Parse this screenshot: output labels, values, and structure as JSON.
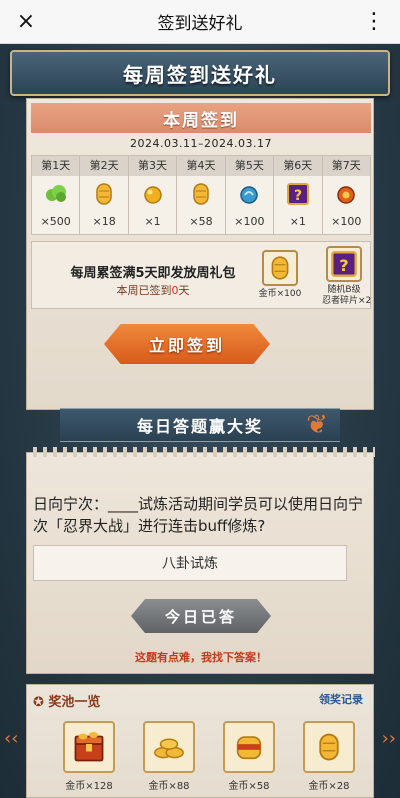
{
  "topbar": {
    "title": "签到送好礼",
    "close_icon": "×",
    "more_icon": "⋮"
  },
  "header": {
    "title": "每周签到送好礼"
  },
  "weekly_signin": {
    "title": "本周签到",
    "date_range": "2024.03.11–2024.03.17",
    "days": [
      {
        "label": "第1天",
        "qty": "×500",
        "icon": "green-cloud-icon",
        "color": "#6fbf3a"
      },
      {
        "label": "第2天",
        "qty": "×18",
        "icon": "coin-icon",
        "color": "#e8a72a"
      },
      {
        "label": "第3天",
        "qty": "×1",
        "icon": "gold-orb-icon",
        "color": "#f0b020"
      },
      {
        "label": "第4天",
        "qty": "×58",
        "icon": "coin-icon",
        "color": "#e8a72a"
      },
      {
        "label": "第5天",
        "qty": "×100",
        "icon": "blue-orb-icon",
        "color": "#3a9ad0"
      },
      {
        "label": "第6天",
        "qty": "×1",
        "icon": "mystery-box-icon",
        "color": "#6a2a8a"
      },
      {
        "label": "第7天",
        "qty": "×100",
        "icon": "red-orb-icon",
        "color": "#d8501a"
      }
    ],
    "bonus_line1": "每周累签满5天即发放周礼包",
    "bonus_line2_prefix": "本周已签到",
    "bonus_count": "0",
    "bonus_line2_suffix": "天",
    "rewards": [
      {
        "label": "金币×100",
        "icon": "coin-icon"
      },
      {
        "label_line1": "随机B级",
        "label_line2": "忍者碎片×2",
        "icon": "mystery-box-icon"
      }
    ],
    "sign_button": "立即签到"
  },
  "quiz": {
    "banner": "每日答题赢大奖",
    "question": "日向宁次：____试炼活动期间学员可以使用日向宁次「忍界大战」进行连击buff修炼?",
    "answer": "八卦试炼",
    "done_button": "今日已答",
    "hint": "这题有点难，我找下答案！"
  },
  "pool": {
    "title": "奖池一览",
    "record_link": "领奖记录",
    "items": [
      {
        "label": "金币×128",
        "icon": "coin-chest-icon"
      },
      {
        "label": "金币×88",
        "icon": "coin-pile-icon"
      },
      {
        "label": "金币×58",
        "icon": "coin-bundle-icon"
      },
      {
        "label": "金币×28",
        "icon": "coin-icon"
      }
    ]
  }
}
